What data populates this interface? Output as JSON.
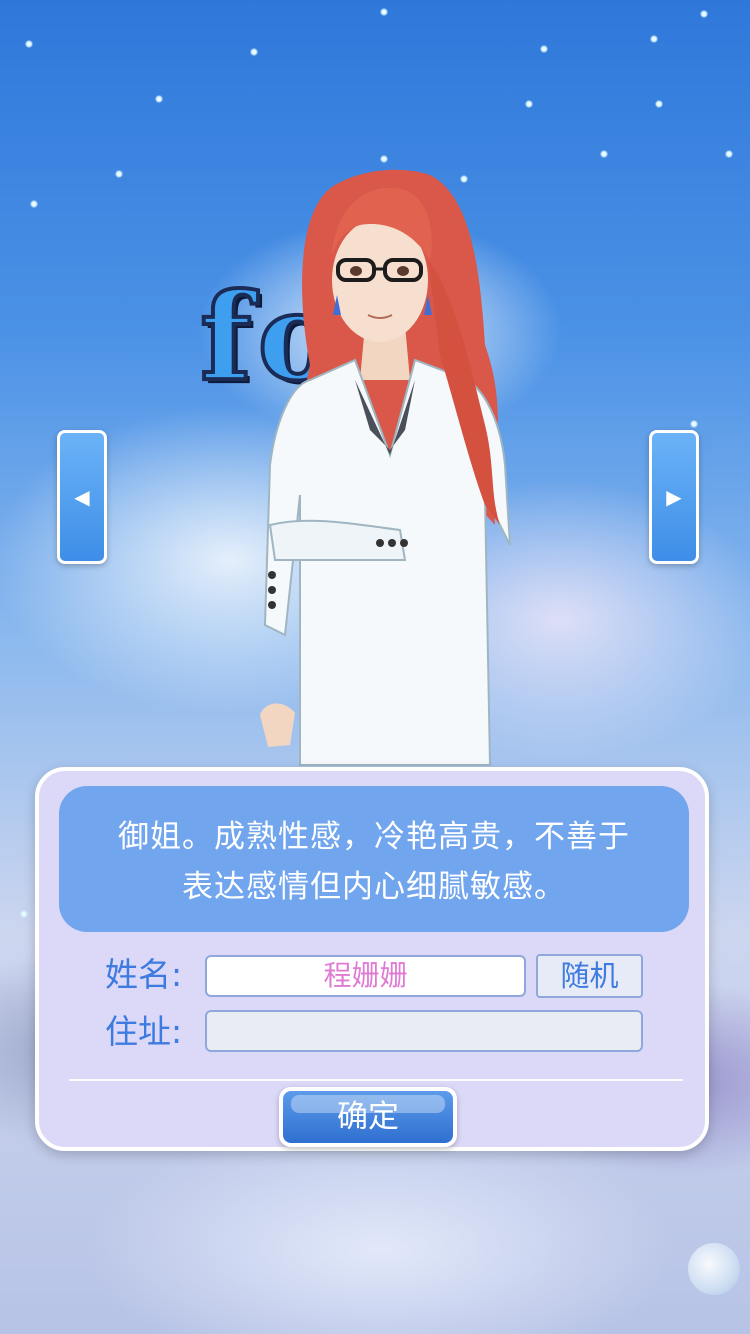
{
  "background": {
    "logo_text": "fo  u"
  },
  "navigation": {
    "prev_icon": "◀",
    "next_icon": "▶"
  },
  "character_card": {
    "description_line1": "御姐。成熟性感，冷艳高贵，不善于",
    "description_line2": "表达感情但内心细腻敏感。",
    "name_label": "姓名:",
    "name_value": "程姗姗",
    "random_label": "随机",
    "address_label": "住址:",
    "address_value": "",
    "confirm_label": "确定"
  },
  "colors": {
    "accent": "#3d7be0",
    "panel": "#dcd9f8",
    "description_box": "#71a5ee",
    "name_text": "#e07bd3"
  }
}
